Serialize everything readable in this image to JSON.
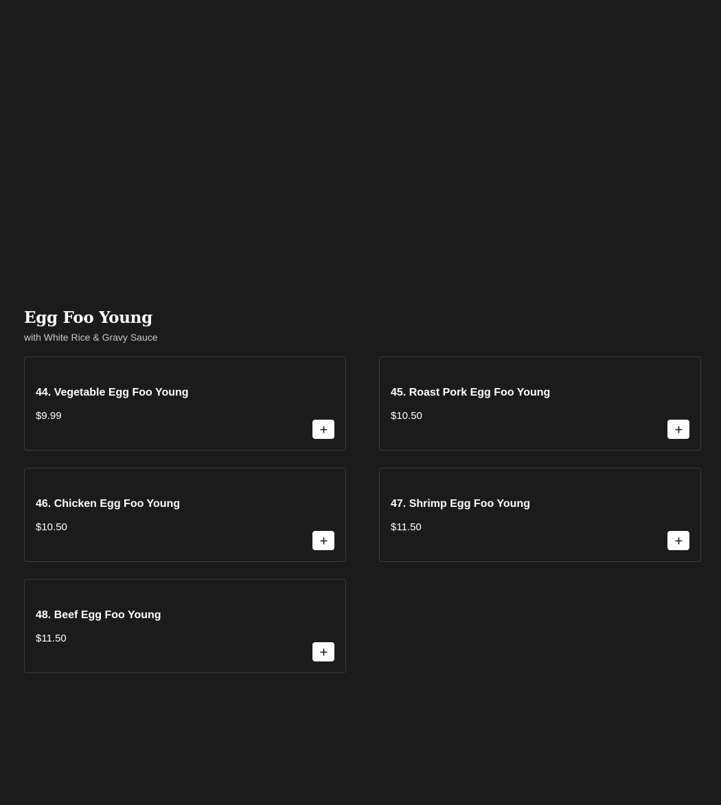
{
  "section": {
    "title": "Egg Foo Young",
    "subtitle": "with White Rice & Gravy Sauce"
  },
  "items": [
    {
      "name": "44. Vegetable Egg Foo Young",
      "price": "$9.99"
    },
    {
      "name": "45. Roast Pork Egg Foo Young",
      "price": "$10.50"
    },
    {
      "name": "46. Chicken Egg Foo Young",
      "price": "$10.50"
    },
    {
      "name": "47. Shrimp Egg Foo Young",
      "price": "$11.50"
    },
    {
      "name": "48. Beef Egg Foo Young",
      "price": "$11.50"
    }
  ],
  "icons": {
    "add": "plus-icon"
  },
  "colors": {
    "background": "#1b1b1b",
    "card_border": "#3a3a3a",
    "text": "#ffffff",
    "subtitle": "#c9c9c9",
    "button_bg": "#ffffff",
    "button_icon": "#1b1b1b"
  }
}
